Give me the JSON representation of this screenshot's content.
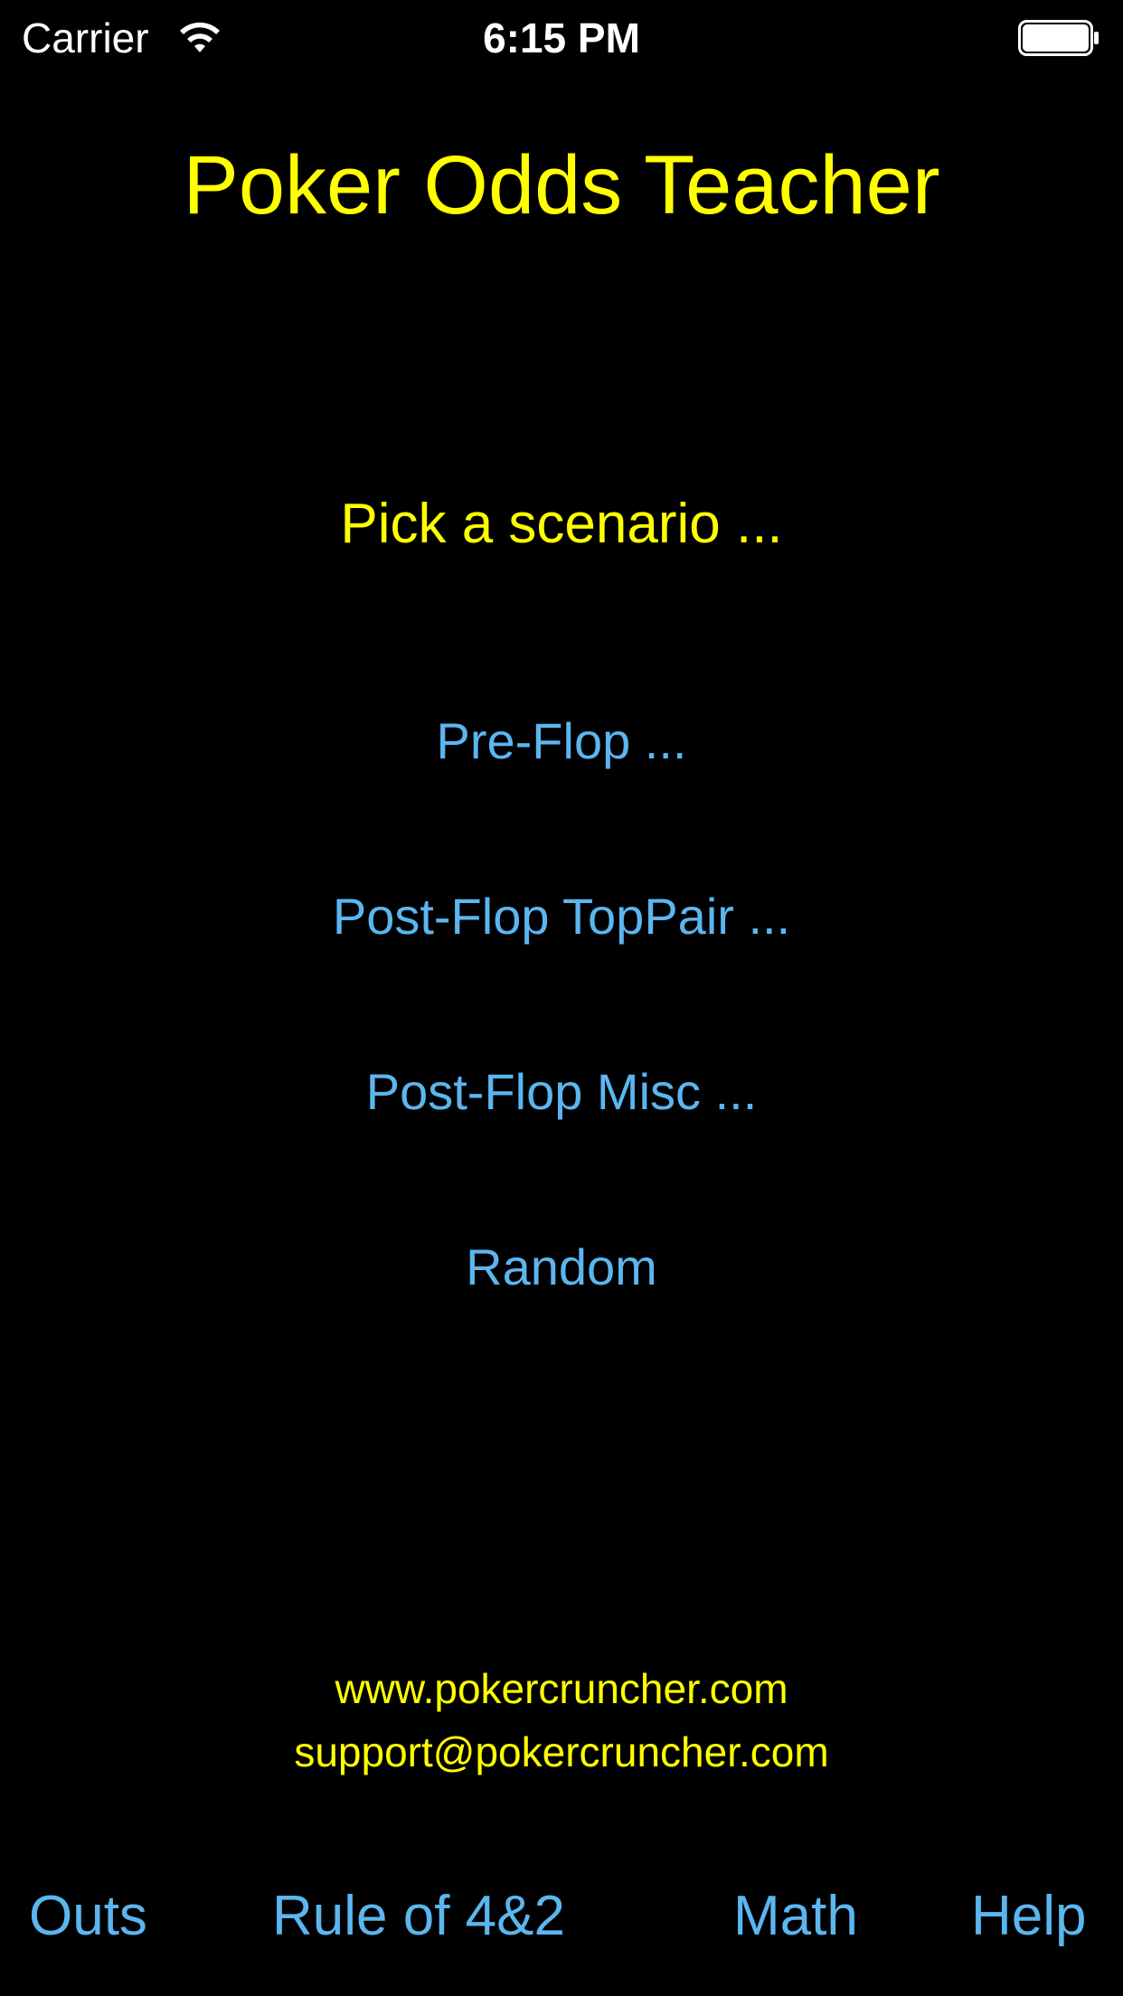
{
  "status_bar": {
    "carrier": "Carrier",
    "time": "6:15 PM",
    "wifi_icon": "wifi-icon",
    "battery_icon": "battery-icon"
  },
  "header": {
    "title": "Poker Odds Teacher"
  },
  "main": {
    "prompt": "Pick a scenario ...",
    "scenarios": [
      {
        "label": "Pre-Flop ..."
      },
      {
        "label": "Post-Flop TopPair ..."
      },
      {
        "label": "Post-Flop Misc ..."
      },
      {
        "label": "Random"
      }
    ]
  },
  "contact": {
    "website": "www.pokercruncher.com",
    "email": "support@pokercruncher.com"
  },
  "bottom_nav": {
    "items": [
      {
        "label": "Outs"
      },
      {
        "label": "Rule of 4&2"
      },
      {
        "label": "Math"
      },
      {
        "label": "Help"
      }
    ]
  },
  "colors": {
    "background": "#000000",
    "title_yellow": "#ffff00",
    "link_blue": "#5bb6f0",
    "status_white": "#ffffff"
  }
}
